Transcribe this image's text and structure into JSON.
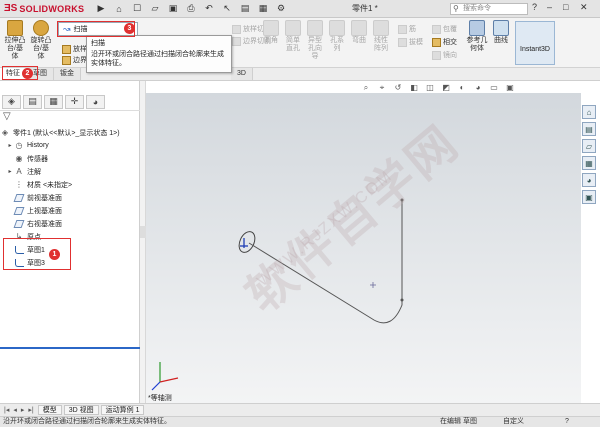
{
  "app": {
    "brand": "SOLIDWORKS",
    "document_title": "零件1 *",
    "search_placeholder": "搜索命令"
  },
  "ribbon": {
    "buttons": [
      {
        "label": "拉伸凸台/基体"
      },
      {
        "label": "旋转凸台/基体"
      },
      {
        "label": "扫描"
      },
      {
        "label": "放样"
      },
      {
        "label": "边界"
      }
    ],
    "grey_buttons": [
      {
        "label": "圆角"
      },
      {
        "label": "简单直孔"
      },
      {
        "label": "异型孔向导"
      },
      {
        "label": "孔系列"
      },
      {
        "label": "弯曲"
      },
      {
        "label": "线性阵列"
      },
      {
        "label": "筋"
      },
      {
        "label": "拔模"
      },
      {
        "label": "包覆"
      },
      {
        "label": "相交"
      },
      {
        "label": "镜向"
      }
    ],
    "side_items": [
      "放样切割",
      "边界切割"
    ],
    "ref_geometry": "参考几何体",
    "curves": "曲线",
    "instant3d": "Instant3D"
  },
  "sweep_dropdown": {
    "label": "扫描"
  },
  "tooltip": {
    "title": "扫描",
    "description": "沿开环或闭合路径通过扫描闭合轮廓来生成实体特征。"
  },
  "tabs": [
    {
      "label": "特征",
      "active": true
    },
    {
      "label": "草图"
    },
    {
      "label": "钣金"
    },
    {
      "label": "3D"
    }
  ],
  "tree": {
    "root": "零件1 (默认<<默认>_显示状态 1>)",
    "items": [
      {
        "label": "History",
        "expand": "▸"
      },
      {
        "label": "传感器",
        "expand": ""
      },
      {
        "label": "注解",
        "expand": "▸"
      },
      {
        "label": "材质 <未指定>",
        "expand": ""
      },
      {
        "label": "前视基准面",
        "expand": ""
      },
      {
        "label": "上视基准面",
        "expand": ""
      },
      {
        "label": "右视基准面",
        "expand": ""
      },
      {
        "label": "原点",
        "expand": ""
      },
      {
        "label": "草图1",
        "expand": ""
      },
      {
        "label": "草图3",
        "expand": ""
      }
    ]
  },
  "view": {
    "orientation": "*等轴测"
  },
  "bottom_tabs": [
    "模型",
    "3D 视图",
    "运动算例 1"
  ],
  "status": {
    "message": "沿开环或闭合路径通过扫描闭合轮廓来生成实体特征。",
    "edit_state": "在编辑 草图",
    "units": "自定义"
  },
  "annotations": [
    {
      "number": "1"
    },
    {
      "number": "2"
    },
    {
      "number": "3"
    }
  ],
  "watermark": {
    "text": "软件自学网",
    "url_text": "WWW.RJZXW.COM"
  },
  "colors": {
    "brand_red": "#c8102e",
    "highlight_red": "#e03030",
    "accent_blue": "#2b67c7"
  }
}
